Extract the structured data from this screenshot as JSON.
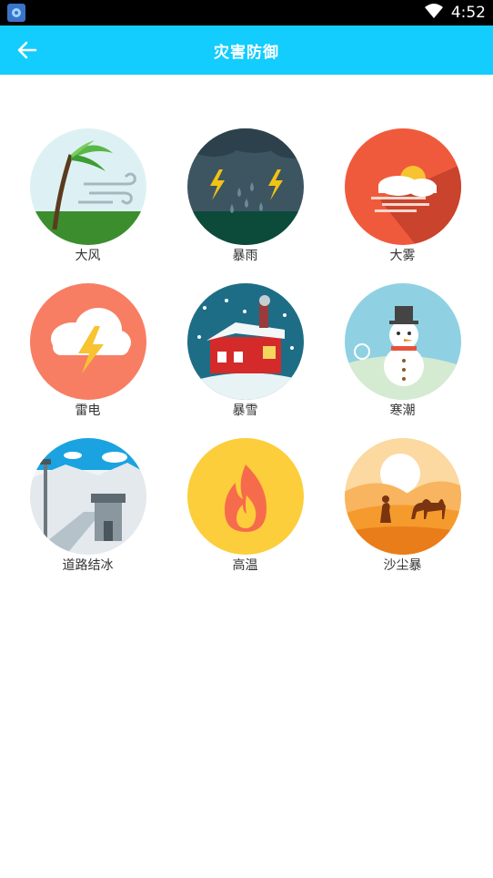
{
  "status": {
    "time": "4:52"
  },
  "header": {
    "title": "灾害防御"
  },
  "items": [
    {
      "label": "大风"
    },
    {
      "label": "暴雨"
    },
    {
      "label": "大雾"
    },
    {
      "label": "雷电"
    },
    {
      "label": "暴雪"
    },
    {
      "label": "寒潮"
    },
    {
      "label": "道路结冰"
    },
    {
      "label": "高温"
    },
    {
      "label": "沙尘暴"
    }
  ],
  "colors": {
    "appbar": "#12cdfd",
    "statusbar": "#000000"
  }
}
